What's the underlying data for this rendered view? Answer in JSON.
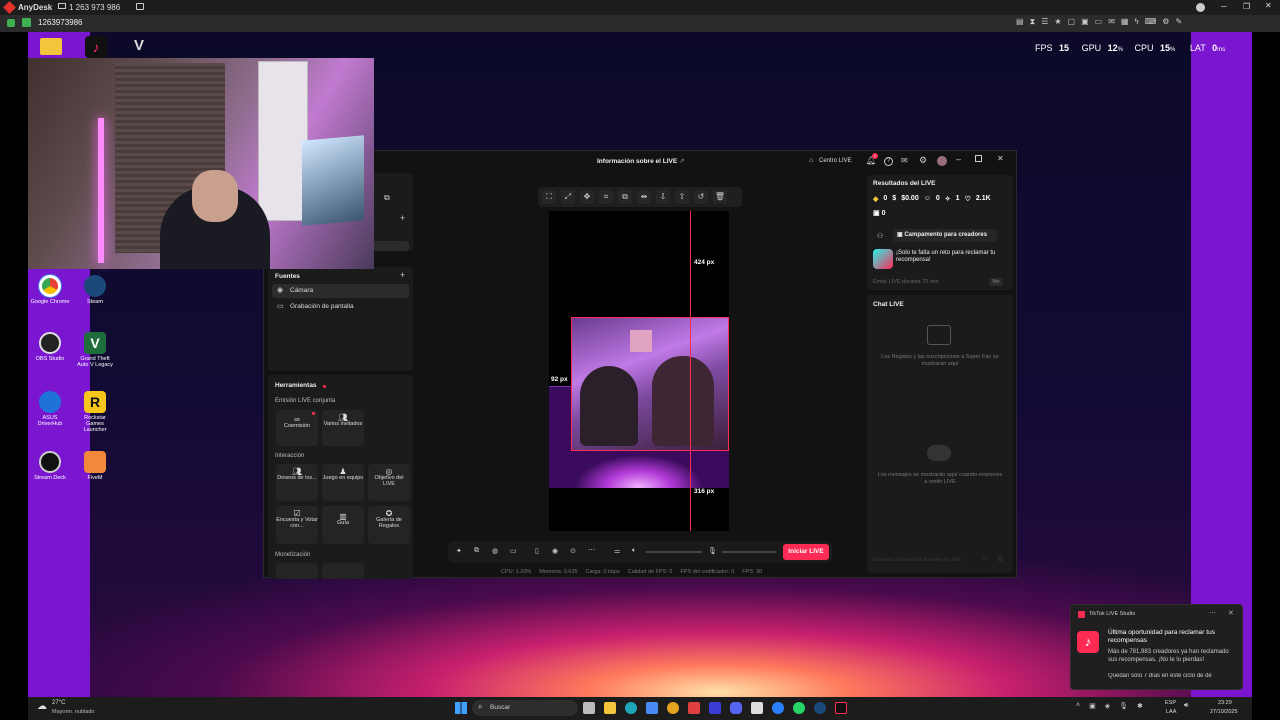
{
  "app": {
    "name": "AnyDesk",
    "session_id": "1 263 973 986",
    "tab_id": "1263973986"
  },
  "overlay_stats": {
    "fps_label": "FPS",
    "fps": "15",
    "gpu_label": "GPU",
    "gpu": "12",
    "cpu_label": "CPU",
    "cpu": "15",
    "lat_label": "LAT",
    "lat": "0",
    "pct": "%",
    "ms": "ms"
  },
  "desktop_icons": [
    {
      "label": "Google Chrome",
      "color": "#e3a41f"
    },
    {
      "label": "Steam",
      "color": "#1b4a7a"
    },
    {
      "label": "OBS Studio",
      "color": "#222222"
    },
    {
      "label": "Grand Theft Auto V Legacy",
      "color": "#1f6d3a"
    },
    {
      "label": "ASUS DriverHub",
      "color": "#1e72d8"
    },
    {
      "label": "Rockstar Games Launcher",
      "color": "#f7c61a"
    },
    {
      "label": "Stream Deck",
      "color": "#111111"
    },
    {
      "label": "FiveM",
      "color": "#f2883a"
    }
  ],
  "live_window": {
    "title": "Información sobre el LIVE",
    "centro_live": "Centro LIVE",
    "notif_count": "1"
  },
  "left_panel": {
    "fuentes_title": "Fuentes",
    "fuentes": [
      "Cámara",
      "Grabación de pantalla"
    ],
    "herramientas_title": "Herramientas",
    "emision_title": "Emisión LIVE conjunta",
    "emision": [
      "Coemisión",
      "Varios invitados"
    ],
    "interaccion_title": "Interacción",
    "interaccion": [
      "Deseos de los...",
      "Juego en equipo",
      "Objetivo del LIVE",
      "Encuesta y Votar con...",
      "Guía",
      "Galería de Regalos"
    ],
    "monetizacion_title": "Monetización"
  },
  "canvas": {
    "measure_top": "424 px",
    "measure_left": "92 px",
    "measure_bottom": "316 px"
  },
  "bottom_controls": {
    "start_button": "Iniciar LIVE"
  },
  "stats_bar": [
    "CPU: 1.20%",
    "Memoria: 0.635",
    "Carga: 0 kbps",
    "Calidad de FPS: 0",
    "FPS del codificador: 0",
    "FPS: 30"
  ],
  "results": {
    "title": "Resultados del LIVE",
    "coins": "0",
    "money": "$0.00",
    "viewers": "0",
    "shares": "1",
    "likes": "2.1K",
    "gifts": "0",
    "campaign_button": "Campamento para creadores",
    "promo_text": "¡Solo te falta un reto para reclamar tu recompensa!",
    "task_text": "Emite LIVE durante 70 min",
    "task_badge": "Ver"
  },
  "chat": {
    "title": "Chat LIVE",
    "gifts_msg": "Los Regalos y las suscripciones a Super Fan se mostrarán aquí",
    "messages_msg": "Los mensajes se mostrarán aquí cuando empieces a emitir LIVE",
    "input_placeholder": "Chatear comentario durante el LIVE"
  },
  "toast": {
    "app": "TikTok LIVE Studio",
    "headline": "Última oportunidad para reclamar tus recompensas",
    "body": "Más de 781,983 creadores ya han reclamado sus recompensas. ¡No te lo pierdas!",
    "footer": "Quedan solo 7 días en este ciclo de de"
  },
  "taskbar": {
    "weather_temp": "27°C",
    "weather_desc": "Mayorm. nublado",
    "search_placeholder": "Buscar",
    "lang1": "ESP",
    "lang2": "LAA",
    "time": "23:29",
    "date": "27/10/2025"
  }
}
